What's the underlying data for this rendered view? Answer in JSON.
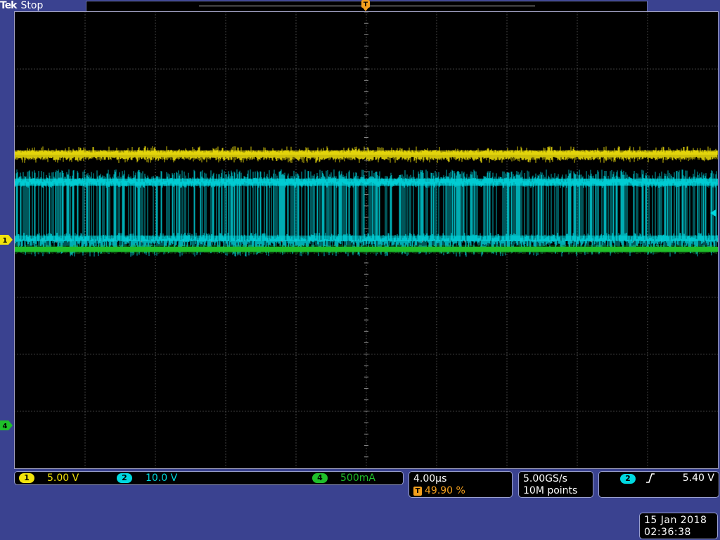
{
  "header": {
    "brand": "Tek",
    "acquisition_state": "Stop"
  },
  "markers": {
    "trigger_position": "T",
    "channel_1": "1",
    "channel_4": "4"
  },
  "channels": [
    {
      "id": "1",
      "scale": "5.00 V",
      "color": "#f2e30c"
    },
    {
      "id": "2",
      "scale": "10.0 V",
      "color": "#00d8e0"
    },
    {
      "id": "4",
      "scale": "500mA",
      "color": "#1fbf2a"
    }
  ],
  "horizontal": {
    "timebase": "4.00µs",
    "trigger_position": "49.90 %"
  },
  "acquisition": {
    "sample_rate": "5.00GS/s",
    "record_length": "10M points"
  },
  "trigger": {
    "source": "2",
    "slope": "rising",
    "level": "5.40 V"
  },
  "datetime": {
    "date": "15 Jan  2018",
    "time": "02:36:38"
  },
  "colors": {
    "background": "#3a4290",
    "graticule": "#5a5a5a",
    "trigger_marker": "#f5a01e"
  },
  "icons": [
    "trigger-position-icon",
    "channel-1-ground-marker-icon",
    "channel-4-ground-marker-icon",
    "trigger-level-marker-icon",
    "rising-edge-icon"
  ]
}
